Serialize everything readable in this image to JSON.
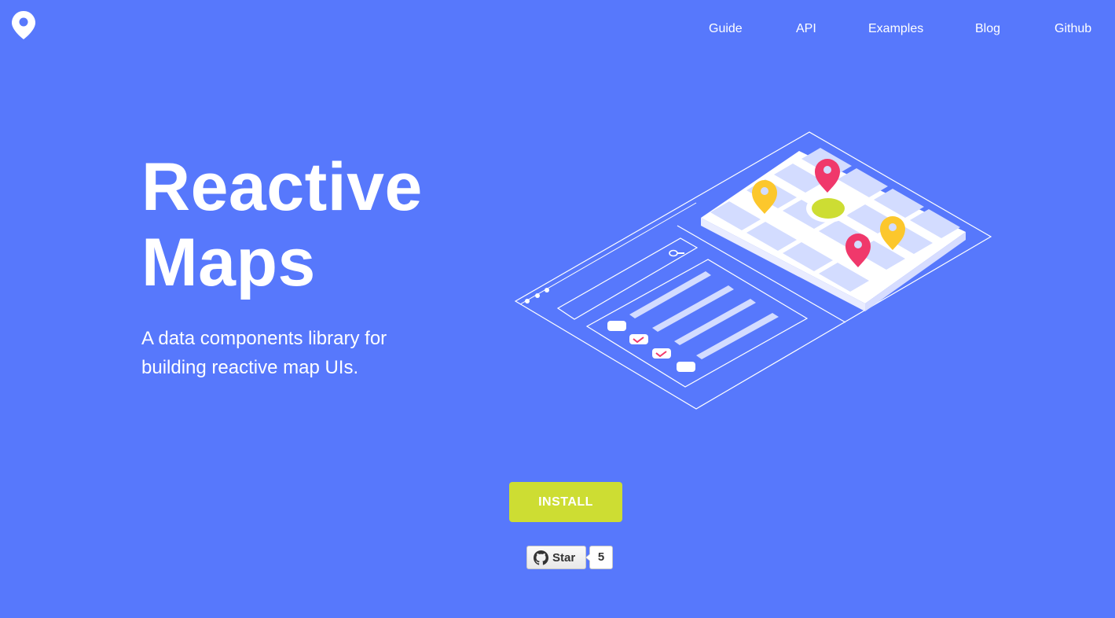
{
  "brand": {
    "logo_icon": "map-pin-icon",
    "background_color": "#5778fc",
    "accent_color": "#cddd33"
  },
  "nav": {
    "items": [
      {
        "label": "Guide"
      },
      {
        "label": "API"
      },
      {
        "label": "Examples"
      },
      {
        "label": "Blog"
      },
      {
        "label": "Github"
      }
    ]
  },
  "hero": {
    "title_line1": "Reactive",
    "title_line2": "Maps",
    "subtitle": "A data components library for building reactive map UIs.",
    "illustration_icon": "isometric-map-ui-icon"
  },
  "install": {
    "label": "INSTALL"
  },
  "github_star": {
    "icon": "github-icon",
    "label": "Star",
    "count": "5"
  }
}
